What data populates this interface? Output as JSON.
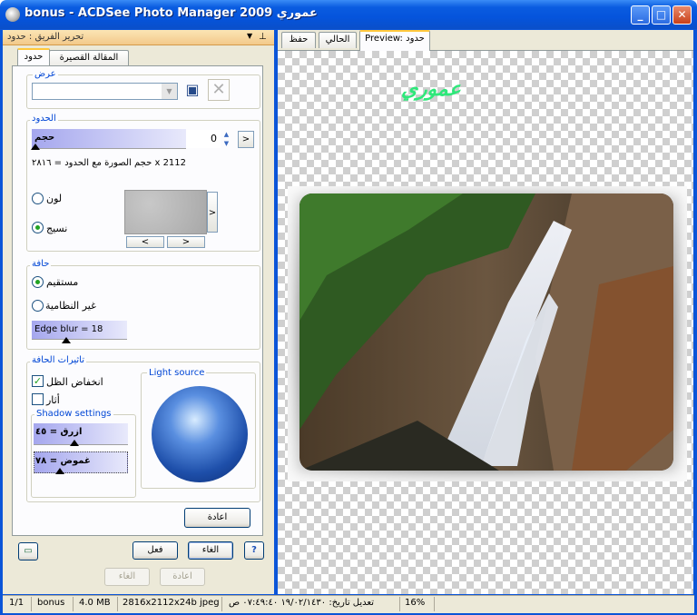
{
  "window": {
    "title": "bonus - ACDSee Photo Manager 2009 عموري"
  },
  "edit_pane": {
    "title": "تحرير الفريق : حدود"
  },
  "tabs": [
    {
      "label": "حدود"
    },
    {
      "label": "المقالة القصيرة"
    }
  ],
  "view_group": {
    "title": "عرض",
    "preset_value": ""
  },
  "borders_group": {
    "title": "الحدود",
    "size_label": "حجم",
    "size_value": "0",
    "size_note": "2112 x حجم الصورة مع الحدود = ٢٨١٦",
    "color_label": "لون",
    "texture_label": "نسيج",
    "prev_btn": "<",
    "next_btn": ">"
  },
  "edge_group": {
    "title": "حافة",
    "straight_label": "مستقيم",
    "irregular_label": "غير النظامية",
    "edge_blur": "Edge blur = 18"
  },
  "effects_group": {
    "title": "تاثيرات الحافة",
    "drop_shadow_label": "انخفاض الظل",
    "bevel_label": "أثار",
    "shadow_settings": "Shadow settings",
    "blue_value": "ازرق = ٤٥",
    "depth_value": "غموض = ٧٨",
    "light_source": "Light source"
  },
  "buttons": {
    "reset": "اعادة",
    "done": "فعل",
    "cancel": "الغاء",
    "undo": "الغاء",
    "redo": "اعادة",
    "help": "?"
  },
  "preview_tabs": [
    {
      "label": "Preview: حدود"
    },
    {
      "label": "الحالي"
    },
    {
      "label": "حفظ"
    }
  ],
  "status": {
    "page": "1/1",
    "file": "bonus",
    "size": "4.0 MB",
    "dims": "2816x2112x24b jpeg",
    "modified": "تعديل تاريخ: ١٩/٠٢/١٤٣٠ ٠٧:٤٩:٤٠ ص",
    "zoom": "16%"
  },
  "watermark_text": "عموري",
  "chart_data": null,
  "colors": {
    "accent": "#0054e3",
    "pane_header": "#f3c98a",
    "wm": "#2ee87a"
  }
}
